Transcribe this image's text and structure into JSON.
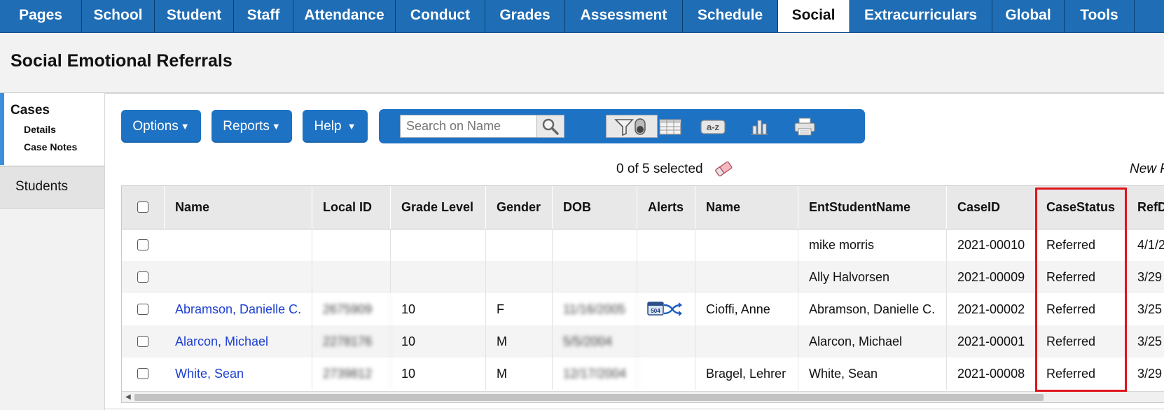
{
  "nav": {
    "tabs": [
      "Pages",
      "School",
      "Student",
      "Staff",
      "Attendance",
      "Conduct",
      "Grades",
      "Assessment",
      "Schedule",
      "Social",
      "Extracurriculars",
      "Global",
      "Tools"
    ],
    "active": "Social"
  },
  "page": {
    "title": "Social Emotional Referrals"
  },
  "sidebar": {
    "section_label": "Cases",
    "sub_items": [
      "Details",
      "Case Notes"
    ],
    "students_label": "Students"
  },
  "buttons": {
    "options": "Options",
    "reports": "Reports",
    "help": "Help"
  },
  "search": {
    "placeholder": "Search on Name",
    "value": ""
  },
  "toolbar_icons": [
    "search-icon",
    "filter-toggle-icon",
    "grid-icon",
    "sort-az-icon",
    "chart-icon",
    "printer-icon"
  ],
  "selection": {
    "count_text": "0 of 5 selected",
    "new_label": "New R"
  },
  "grid": {
    "columns": [
      "Name",
      "Local ID",
      "Grade Level",
      "Gender",
      "DOB",
      "Alerts",
      "Name",
      "EntStudentName",
      "CaseID",
      "CaseStatus",
      "RefD"
    ],
    "rows": [
      {
        "name": "",
        "local_id": "",
        "grade": "",
        "gender": "",
        "dob": "",
        "alerts": false,
        "name2": "",
        "ent_name": "mike morris",
        "case_id": "2021-00010",
        "status": "Referred",
        "ref_date": "4/1/2"
      },
      {
        "name": "",
        "local_id": "",
        "grade": "",
        "gender": "",
        "dob": "",
        "alerts": false,
        "name2": "",
        "ent_name": "Ally Halvorsen",
        "case_id": "2021-00009",
        "status": "Referred",
        "ref_date": "3/29"
      },
      {
        "name": "Abramson, Danielle C.",
        "local_id": "2675909",
        "grade": "10",
        "gender": "F",
        "dob": "11/16/2005",
        "alerts": true,
        "name2": "Cioffi, Anne",
        "ent_name": "Abramson, Danielle C.",
        "case_id": "2021-00002",
        "status": "Referred",
        "ref_date": "3/25"
      },
      {
        "name": "Alarcon, Michael",
        "local_id": "2278176",
        "grade": "10",
        "gender": "M",
        "dob": "5/5/2004",
        "alerts": false,
        "name2": "",
        "ent_name": "Alarcon, Michael",
        "case_id": "2021-00001",
        "status": "Referred",
        "ref_date": "3/25"
      },
      {
        "name": "White, Sean",
        "local_id": "2739812",
        "grade": "10",
        "gender": "M",
        "dob": "12/17/2004",
        "alerts": false,
        "name2": "Bragel, Lehrer",
        "ent_name": "White, Sean",
        "case_id": "2021-00008",
        "status": "Referred",
        "ref_date": "3/29"
      }
    ]
  },
  "colors": {
    "nav_bg": "#1f6db5",
    "button_blue": "#1e72c4",
    "link": "#1d3fd0",
    "highlight": "#e0141c"
  }
}
